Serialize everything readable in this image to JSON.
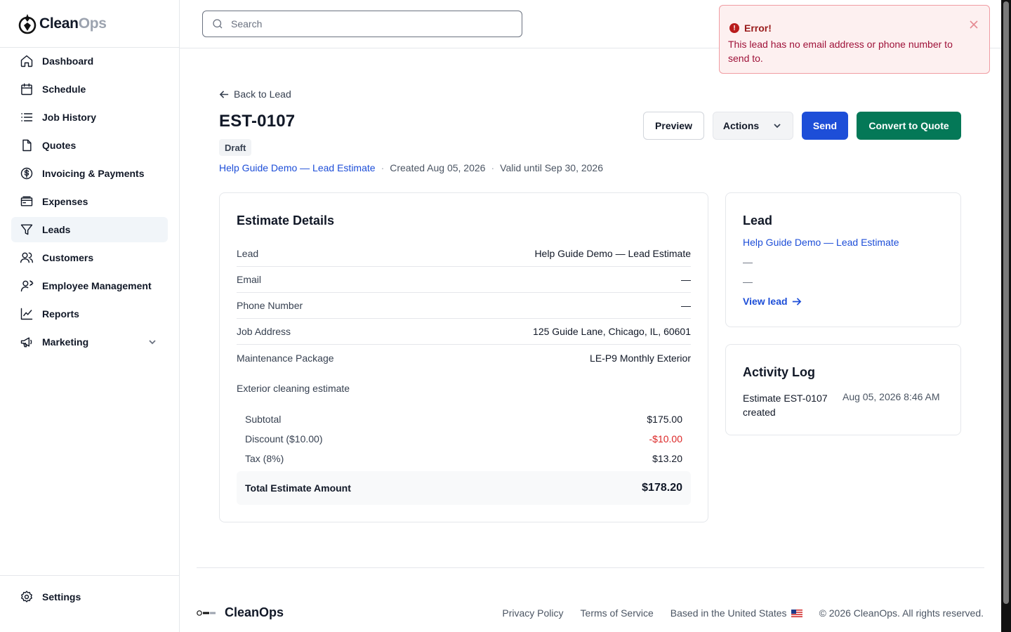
{
  "brand": {
    "name_part1": "Clean",
    "name_part2": "Ops",
    "footer_name": "CleanOps"
  },
  "search": {
    "placeholder": "Search"
  },
  "sidebar": {
    "items": [
      {
        "label": "Dashboard",
        "icon": "home-icon"
      },
      {
        "label": "Schedule",
        "icon": "calendar-icon"
      },
      {
        "label": "Job History",
        "icon": "list-icon"
      },
      {
        "label": "Quotes",
        "icon": "document-icon"
      },
      {
        "label": "Invoicing & Payments",
        "icon": "dollar-icon"
      },
      {
        "label": "Expenses",
        "icon": "receipt-icon"
      },
      {
        "label": "Leads",
        "icon": "filter-icon",
        "active": true
      },
      {
        "label": "Customers",
        "icon": "users-icon"
      },
      {
        "label": "Employee Management",
        "icon": "user-cog-icon"
      },
      {
        "label": "Reports",
        "icon": "chart-icon"
      },
      {
        "label": "Marketing",
        "icon": "megaphone-icon"
      }
    ],
    "settings_label": "Settings"
  },
  "header": {
    "back_label": "Back to Lead",
    "estimate_id": "EST-0107",
    "status": "Draft",
    "lead_link": "Help Guide Demo — Lead Estimate",
    "created": "Created Aug 05, 2026",
    "valid_until": "Valid until Sep 30, 2026",
    "separator": "·"
  },
  "actions": {
    "preview": "Preview",
    "actions": "Actions",
    "send": "Send",
    "convert": "Convert to Quote"
  },
  "details": {
    "title": "Estimate Details",
    "rows": [
      {
        "label": "Lead",
        "value": "Help Guide Demo — Lead Estimate"
      },
      {
        "label": "Email",
        "value": "—"
      },
      {
        "label": "Phone Number",
        "value": "—"
      },
      {
        "label": "Job Address",
        "value": "125 Guide Lane, Chicago, IL, 60601"
      },
      {
        "label": "Maintenance Package",
        "value": "LE-P9 Monthly Exterior"
      }
    ],
    "description": "Exterior cleaning estimate",
    "summary": [
      {
        "label": "Subtotal",
        "value": "$175.00"
      },
      {
        "label": "Discount ($10.00)",
        "value": "-$10.00"
      },
      {
        "label": "Tax (8%)",
        "value": "$13.20"
      }
    ],
    "total_label": "Total Estimate Amount",
    "total_value": "$178.20"
  },
  "lead_card": {
    "title": "Lead",
    "name": "Help Guide Demo — Lead Estimate",
    "email": "—",
    "phone": "—",
    "view_label": "View lead"
  },
  "activity": {
    "title": "Activity Log",
    "entries": [
      {
        "text": "Estimate EST-0107 created",
        "time": "Aug 05, 2026 8:46 AM"
      }
    ]
  },
  "toast": {
    "title": "Error!",
    "message": "This lead has no email address or phone number to send to.",
    "icon_glyph": "!"
  },
  "footer": {
    "privacy": "Privacy Policy",
    "terms": "Terms of Service",
    "based": "Based in the United States",
    "copyright": "© 2026 CleanOps. All rights reserved."
  },
  "colors": {
    "primary": "#1d4ed8",
    "success": "#047857",
    "danger": "#dc2626",
    "toast_bg": "#fdf0f0",
    "toast_border": "#f09ca2"
  }
}
